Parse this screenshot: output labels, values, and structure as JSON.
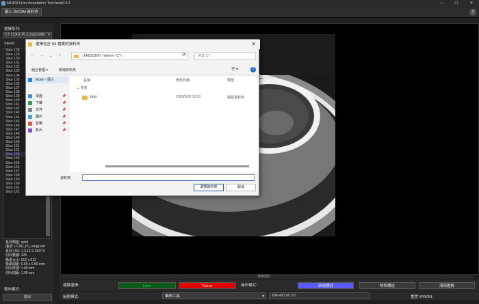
{
  "window": {
    "title": "MUEN Liver Annotation Tool beta0.0.1",
    "controls": [
      "—",
      "☐",
      "✕"
    ]
  },
  "toolbar": {
    "load_label": "載入 DICOM 資料夾",
    "help_label": "?"
  },
  "left": {
    "series_label": "選擇系列:",
    "series_value": "CT: LCAD_PI_LungLowDo",
    "slices_label": "Slices:",
    "slices": [
      "Slice 128",
      "Slice 129",
      "Slice 130",
      "Slice 131",
      "Slice 132",
      "Slice 133",
      "Slice 134",
      "Slice 135",
      "Slice 136",
      "Slice 137",
      "Slice 138",
      "Slice 139",
      "Slice 140",
      "Slice 141",
      "Slice 142",
      "Slice 143",
      "Slice 144",
      "Slice 145",
      "Slice 146",
      "Slice 147",
      "Slice 148",
      "Slice 149",
      "Slice 150",
      "Slice 151",
      "Slice 152",
      "Slice 153",
      "Slice 154",
      "Slice 155",
      "Slice 156",
      "Slice 157",
      "Slice 158",
      "Slice 159",
      "Slice 160",
      "Slice 161",
      "Slice 162"
    ],
    "selected_slice": "Slice 153",
    "info": [
      "系列類型: axial",
      "描述: LCAD_PI_LungLowl",
      "系列 UID: 1.3.12.2.1107.5.",
      "切片數量: 325",
      "像素大小: 512 x 512",
      "像素間距: 0.65 x 0.65 mm",
      "切片厚度: 1.00 mm",
      "切片間距: 1.00 mm"
    ],
    "bottom_label": "輸出模式:",
    "bottom_button": "匯出"
  },
  "viewer": {
    "slice_counter": "153/325"
  },
  "controls": {
    "label_type": "標籤選擇:",
    "liver_label": "Liver",
    "tumor_label": "Tumor",
    "op_mode": "操作模式:",
    "new_label": "新增標註",
    "delete_label": "移除標註",
    "clear_label": "清除圖層",
    "draw_mode": "繪圖模式:",
    "brush_value": "筆刷工具",
    "ww_wl": "WW:400 WL:60",
    "reset_label": "重置 WW/WL",
    "colors": {
      "liver": "#0a5c1a",
      "tumor": "#e00000",
      "new": "#5a5aff"
    }
  },
  "dialog": {
    "title": "選擇包含 NII 檔案的資料夾",
    "close": "✕",
    "path": [
      "148253970",
      "before",
      "CT"
    ],
    "search_placeholder": "搜尋 CT",
    "organize": "組合管理 ▾",
    "new_folder": "新增資料夾",
    "nav": [
      {
        "label": "Muen - 個人",
        "icon": "cloud-icon",
        "color": "#2b7de9"
      },
      {
        "label": "桌面",
        "icon": "desktop-icon",
        "color": "#3a8ee6"
      },
      {
        "label": "下載",
        "icon": "download-icon",
        "color": "#2e9e44"
      },
      {
        "label": "文件",
        "icon": "documents-icon",
        "color": "#7a8899"
      },
      {
        "label": "圖片",
        "icon": "pictures-icon",
        "color": "#3aa0e0"
      },
      {
        "label": "音樂",
        "icon": "music-icon",
        "color": "#e05a3a"
      },
      {
        "label": "影片",
        "icon": "videos-icon",
        "color": "#8a4ae0"
      }
    ],
    "cols": [
      "名稱",
      "修改日期",
      "類型"
    ],
    "group": "今天",
    "files": [
      {
        "name": "tmp",
        "date": "2025/5/20 10:10",
        "type": "檔案資料夾"
      }
    ],
    "filename_label": "資料夾:",
    "select_btn": "選擇資料夾",
    "cancel_btn": "取消"
  }
}
